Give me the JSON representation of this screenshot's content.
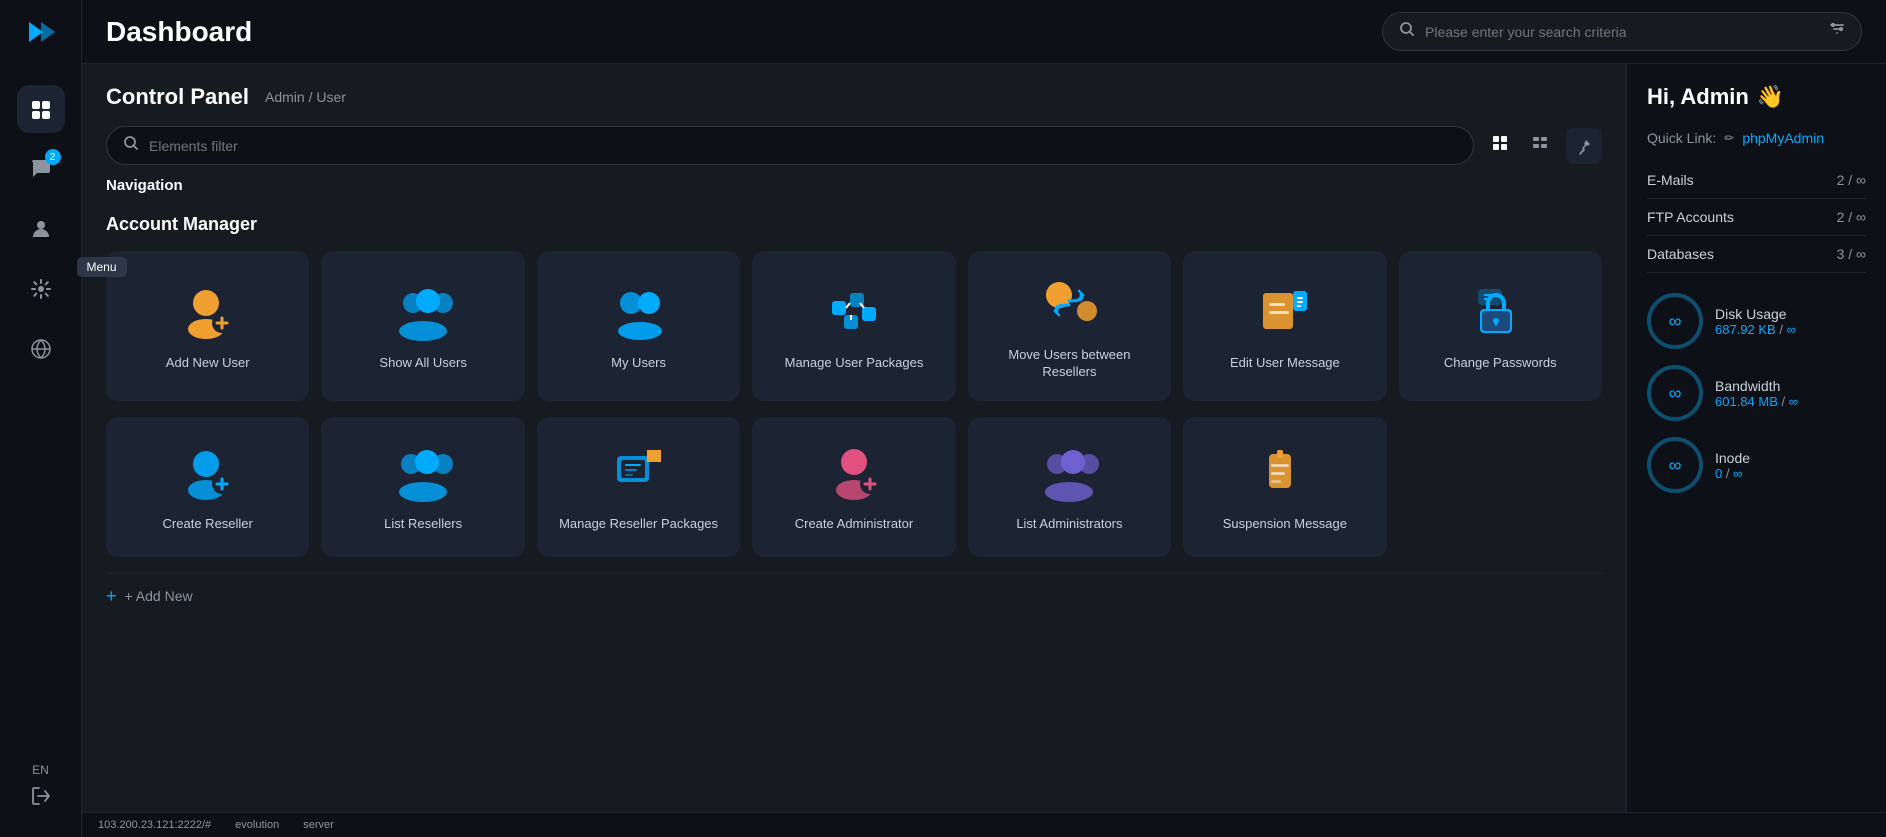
{
  "app": {
    "logo": "▶▶",
    "title": "Dashboard"
  },
  "sidebar": {
    "items": [
      {
        "id": "menu",
        "icon": "⊞",
        "label": "Menu",
        "active": true,
        "badge": null
      },
      {
        "id": "chat",
        "icon": "💬",
        "label": "Chat",
        "active": false,
        "badge": "2"
      },
      {
        "id": "user",
        "icon": "👤",
        "label": "User",
        "active": false,
        "badge": null
      },
      {
        "id": "settings",
        "icon": "⚙",
        "label": "Settings",
        "active": false,
        "badge": null
      },
      {
        "id": "globe",
        "icon": "🌐",
        "label": "Globe",
        "active": false,
        "badge": null
      }
    ],
    "lang": "EN",
    "logout_icon": "→",
    "menu_tooltip": "Menu"
  },
  "topbar": {
    "search_placeholder": "Please enter your search criteria",
    "filter_icon": "⚡"
  },
  "panel": {
    "title": "Control Panel",
    "breadcrumb_admin": "Admin",
    "breadcrumb_sep": "/",
    "breadcrumb_user": "User",
    "filter_placeholder": "Elements filter",
    "nav_items": [
      "Navigation"
    ],
    "section_title": "Account Manager",
    "cards": [
      {
        "id": "add-new-user",
        "label": "Add New User",
        "icon_type": "add-user"
      },
      {
        "id": "show-all-users",
        "label": "Show All Users",
        "icon_type": "show-users"
      },
      {
        "id": "my-users",
        "label": "My Users",
        "icon_type": "my-users"
      },
      {
        "id": "manage-user-packages",
        "label": "Manage User Packages",
        "icon_type": "manage-packages"
      },
      {
        "id": "move-users-between-resellers",
        "label": "Move Users between Resellers",
        "icon_type": "move-users"
      },
      {
        "id": "edit-user-message",
        "label": "Edit User Message",
        "icon_type": "edit-message"
      },
      {
        "id": "change-passwords",
        "label": "Change Passwords",
        "icon_type": "change-passwords"
      }
    ],
    "cards2": [
      {
        "id": "create-reseller",
        "label": "Create Reseller",
        "icon_type": "create-reseller"
      },
      {
        "id": "list-resellers",
        "label": "List Resellers",
        "icon_type": "list-resellers"
      },
      {
        "id": "manage-reseller-packages",
        "label": "Manage Reseller Packages",
        "icon_type": "manage-reseller-packages"
      },
      {
        "id": "create-administrator",
        "label": "Create Administrator",
        "icon_type": "create-admin"
      },
      {
        "id": "list-administrators",
        "label": "List Administrators",
        "icon_type": "list-admins"
      },
      {
        "id": "suspension-message",
        "label": "Suspension Message",
        "icon_type": "suspension-message"
      }
    ],
    "add_new_label": "+ Add New"
  },
  "right_panel": {
    "greeting": "Hi, Admin",
    "greeting_icon": "👋",
    "quick_link_label": "Quick Link:",
    "quick_link_edit_icon": "✏",
    "quick_link_url": "phpMyAdmin",
    "stats": [
      {
        "label": "E-Mails",
        "value": "2 / ∞"
      },
      {
        "label": "FTP Accounts",
        "value": "2 / ∞"
      },
      {
        "label": "Databases",
        "value": "3 / ∞"
      }
    ],
    "gauges": [
      {
        "title": "Disk Usage",
        "value": "687.92 KB",
        "sep": "/",
        "limit": "∞"
      },
      {
        "title": "Bandwidth",
        "value": "601.84 MB",
        "sep": "/",
        "limit": "∞"
      },
      {
        "title": "Inode",
        "value": "0",
        "sep": "/",
        "limit": "∞"
      }
    ]
  },
  "footer": {
    "ip": "103.200.23.121:2222/#",
    "server": "server",
    "evolution": "evolution"
  }
}
